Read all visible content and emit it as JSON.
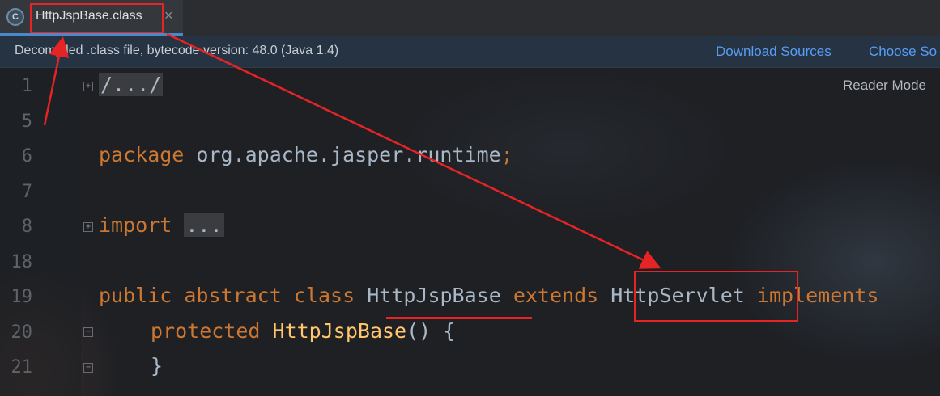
{
  "tab": {
    "icon": "java-class-icon",
    "icon_text": "C",
    "title": "HttpJspBase.class",
    "close": "×"
  },
  "banner": {
    "text": "Decompiled .class file, bytecode version: 48.0 (Java 1.4)",
    "download_sources": "Download Sources",
    "choose_sources": "Choose So"
  },
  "editor": {
    "reader_mode": "Reader Mode",
    "line_numbers": [
      "1",
      "5",
      "6",
      "7",
      "8",
      "18",
      "19",
      "20",
      "21"
    ],
    "lines": {
      "l1": "/.../",
      "l6_kw": "package",
      "l6_rest": " org.apache.jasper.runtime",
      "l6_semi": ";",
      "l8_kw": "import",
      "l8_folded": "...",
      "l19_kw1": "public",
      "l19_kw2": "abstract",
      "l19_kw3": "class",
      "l19_name": "HttpJspBase",
      "l19_kw4": "extends",
      "l19_super": "HttpServlet",
      "l19_kw5": "implements",
      "l20_kw": "protected",
      "l20_fn": "HttpJspBase",
      "l20_rest": "() {",
      "l21": "}"
    }
  },
  "annotations": {
    "color": "#e62325"
  }
}
